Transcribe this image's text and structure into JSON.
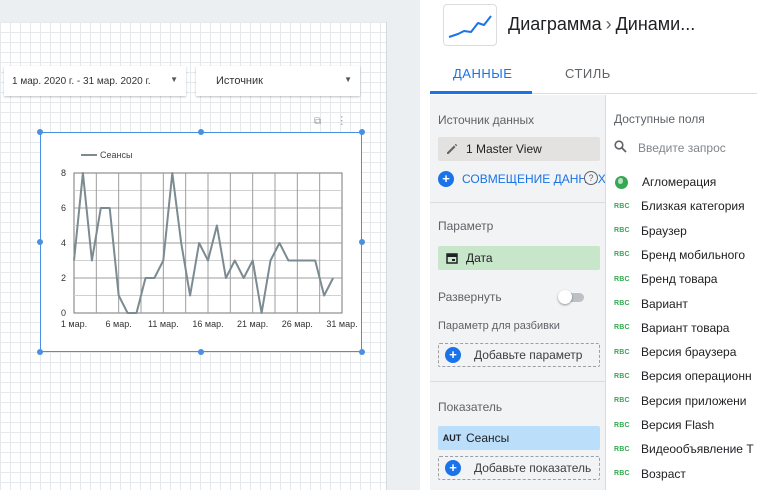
{
  "canvas": {
    "date_control": {
      "value": "1 мар. 2020 г. - 31 мар. 2020 г."
    },
    "source_control": {
      "value": "Источник"
    }
  },
  "chart_data": {
    "type": "line",
    "title": "",
    "xlabel": "",
    "ylabel": "",
    "legend": {
      "position": "top-left"
    },
    "series": [
      {
        "name": "Сеансы",
        "color": "#7b8b91",
        "values": [
          3,
          8,
          3,
          6,
          6,
          1,
          0,
          0,
          2,
          2,
          3,
          8,
          4,
          1,
          4,
          3,
          5,
          2,
          3,
          2,
          3,
          0,
          3,
          4,
          3,
          3,
          3,
          3,
          1,
          2
        ]
      }
    ],
    "x": [
      1,
      2,
      3,
      4,
      5,
      6,
      7,
      8,
      9,
      10,
      11,
      12,
      13,
      14,
      15,
      16,
      17,
      18,
      19,
      20,
      21,
      22,
      23,
      24,
      25,
      26,
      27,
      28,
      29,
      30
    ],
    "x_ticks": [
      {
        "x": 1,
        "label": "1 мар."
      },
      {
        "x": 6,
        "label": "6 мар."
      },
      {
        "x": 11,
        "label": "11 мар."
      },
      {
        "x": 16,
        "label": "16 мар."
      },
      {
        "x": 21,
        "label": "21 мар."
      },
      {
        "x": 26,
        "label": "26 мар."
      },
      {
        "x": 31,
        "label": "31 мар."
      }
    ],
    "xlim": [
      1,
      31
    ],
    "y_ticks": [
      0,
      2,
      4,
      6,
      8
    ],
    "ylim": [
      0,
      8
    ],
    "grid": true
  },
  "panel": {
    "title": "Диаграмма",
    "subtitle": "Динами...",
    "tabs": [
      {
        "label": "ДАННЫЕ",
        "active": true
      },
      {
        "label": "СТИЛЬ",
        "active": false
      }
    ],
    "data_source": {
      "label": "Источник данных",
      "value": "1 Master View",
      "blend_link": "СОВМЕЩЕНИЕ ДАННЫХ"
    },
    "parameter": {
      "label": "Параметр",
      "value": "Дата"
    },
    "expand": {
      "label": "Развернуть",
      "on": false
    },
    "breakdown": {
      "label": "Параметр для разбивки",
      "add_label": "Добавьте параметр"
    },
    "metric": {
      "label": "Показатель",
      "type": "AUT",
      "value": "Сеансы",
      "add_label": "Добавьте показатель"
    },
    "available_fields": {
      "label": "Доступные поля",
      "search_placeholder": "Введите запрос",
      "items": [
        {
          "type": "geo",
          "name": "Агломерация"
        },
        {
          "type": "RBC",
          "name": "Близкая категория"
        },
        {
          "type": "RBC",
          "name": "Браузер"
        },
        {
          "type": "RBC",
          "name": "Бренд мобильного"
        },
        {
          "type": "RBC",
          "name": "Бренд товара"
        },
        {
          "type": "RBC",
          "name": "Вариант"
        },
        {
          "type": "RBC",
          "name": "Вариант товара"
        },
        {
          "type": "RBC",
          "name": "Версия браузера"
        },
        {
          "type": "RBC",
          "name": "Версия операционн"
        },
        {
          "type": "RBC",
          "name": "Версия приложени"
        },
        {
          "type": "RBC",
          "name": "Версия Flash"
        },
        {
          "type": "RBC",
          "name": "Видеообъявление Т"
        },
        {
          "type": "RBC",
          "name": "Возраст"
        }
      ]
    }
  }
}
